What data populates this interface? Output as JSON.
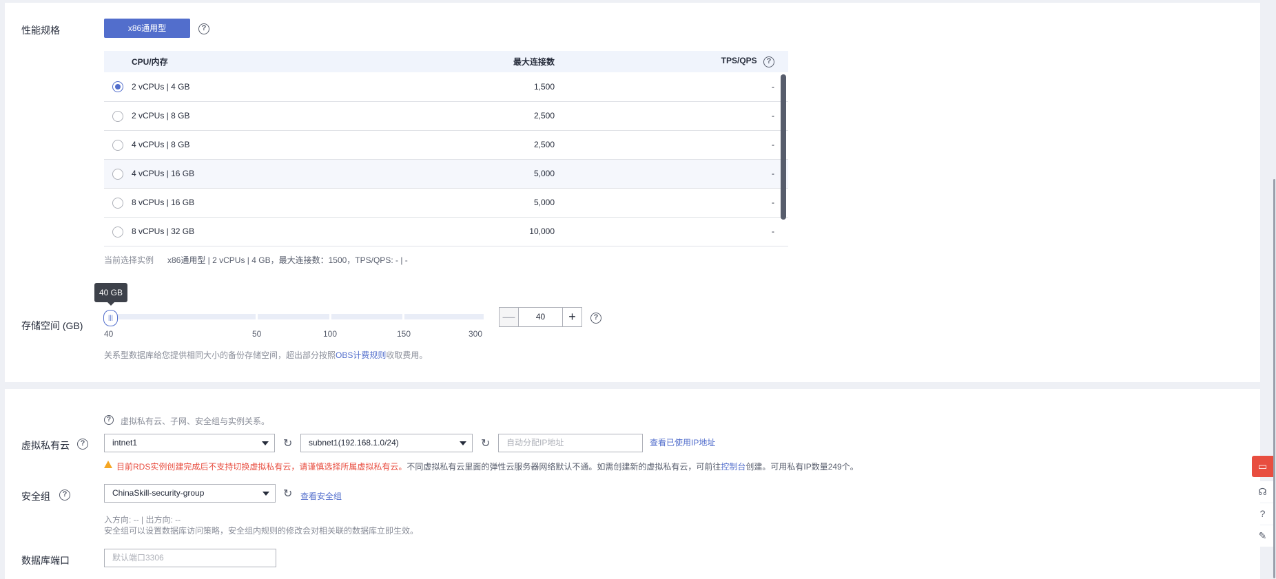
{
  "spec": {
    "label": "性能规格",
    "type_button": "x86通用型",
    "help_icon": "?",
    "columns": [
      "CPU/内存",
      "最大连接数",
      "TPS/QPS"
    ],
    "rows": [
      {
        "cpu": "2 vCPUs | 4 GB",
        "conn": "1,500",
        "tps": "-",
        "selected": true
      },
      {
        "cpu": "2 vCPUs | 8 GB",
        "conn": "2,500",
        "tps": "-",
        "selected": false
      },
      {
        "cpu": "4 vCPUs | 8 GB",
        "conn": "2,500",
        "tps": "-",
        "selected": false
      },
      {
        "cpu": "4 vCPUs | 16 GB",
        "conn": "5,000",
        "tps": "-",
        "selected": false
      },
      {
        "cpu": "8 vCPUs | 16 GB",
        "conn": "5,000",
        "tps": "-",
        "selected": false
      },
      {
        "cpu": "8 vCPUs | 32 GB",
        "conn": "10,000",
        "tps": "-",
        "selected": false
      }
    ],
    "current_label": "当前选择实例",
    "current_value": "x86通用型 | 2 vCPUs | 4 GB，最大连接数：1500，TPS/QPS: - | -"
  },
  "storage": {
    "label": "存储空间 (GB)",
    "tooltip": "40 GB",
    "ticks": [
      "40",
      "50",
      "100",
      "150",
      "300"
    ],
    "value": "40",
    "minus": "—",
    "plus": "+",
    "note_prefix": "关系型数据库给您提供相同大小的备份存储空间，超出部分按照",
    "note_link": "OBS计费规则",
    "note_suffix": "收取费用。"
  },
  "network": {
    "hint": "虚拟私有云、子网、安全组与实例关系。",
    "vpc_label": "虚拟私有云",
    "vpc_value": "intnet1",
    "subnet_value": "subnet1(192.168.1.0/24)",
    "ip_placeholder": "自动分配IP地址",
    "ip_link": "查看已使用IP地址",
    "warn_red": "目前RDS实例创建完成后不支持切换虚拟私有云，请谨慎选择所属虚拟私有云。",
    "warn_gray": "不同虚拟私有云里面的弹性云服务器网络默认不通。如需创建新的虚拟私有云，可前往",
    "warn_link": "控制台",
    "warn_tail": "创建。可用私有IP数量249个。",
    "sg_label": "安全组",
    "sg_value": "ChinaSkill-security-group",
    "sg_link": "查看安全组",
    "sg_dir": "入方向: -- | 出方向: --",
    "sg_note": "安全组可以设置数据库访问策略，安全组内规则的修改会对相关联的数据库立即生效。",
    "port_label": "数据库端口",
    "port_placeholder": "默认端口3306"
  },
  "sidebar": {
    "icons": [
      "chat-icon",
      "headset-icon",
      "help-icon",
      "feedback-icon"
    ]
  }
}
